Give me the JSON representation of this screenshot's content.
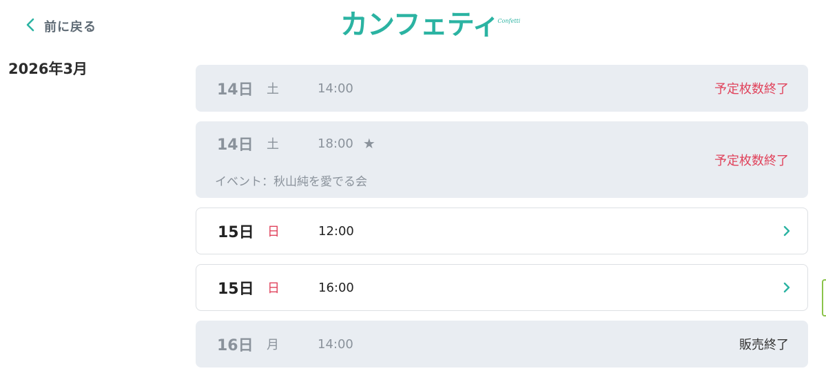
{
  "header": {
    "back_label": "前に戻る",
    "logo_text": "カンフェティ",
    "logo_subtext": "Confetti"
  },
  "month_heading": "2026年3月",
  "performances": [
    {
      "day": "14日",
      "weekday": "土",
      "time": "14:00",
      "status": "予定枚数終了"
    },
    {
      "day": "14日",
      "weekday": "土",
      "time": "18:00",
      "star": "★",
      "status": "予定枚数終了",
      "note": "イベント：秋山純を愛でる会"
    },
    {
      "day": "15日",
      "weekday": "日",
      "time": "12:00"
    },
    {
      "day": "15日",
      "weekday": "日",
      "time": "16:00"
    },
    {
      "day": "16日",
      "weekday": "月",
      "time": "14:00",
      "status": "販売終了"
    }
  ],
  "colors": {
    "accent": "#2bb3a2",
    "sold_out": "#e0425b",
    "sunday": "#e0425b",
    "disabled_bg": "#e9edf2"
  },
  "icons": {
    "back": "chevron-left-icon",
    "row_arrow": "chevron-right-icon"
  }
}
